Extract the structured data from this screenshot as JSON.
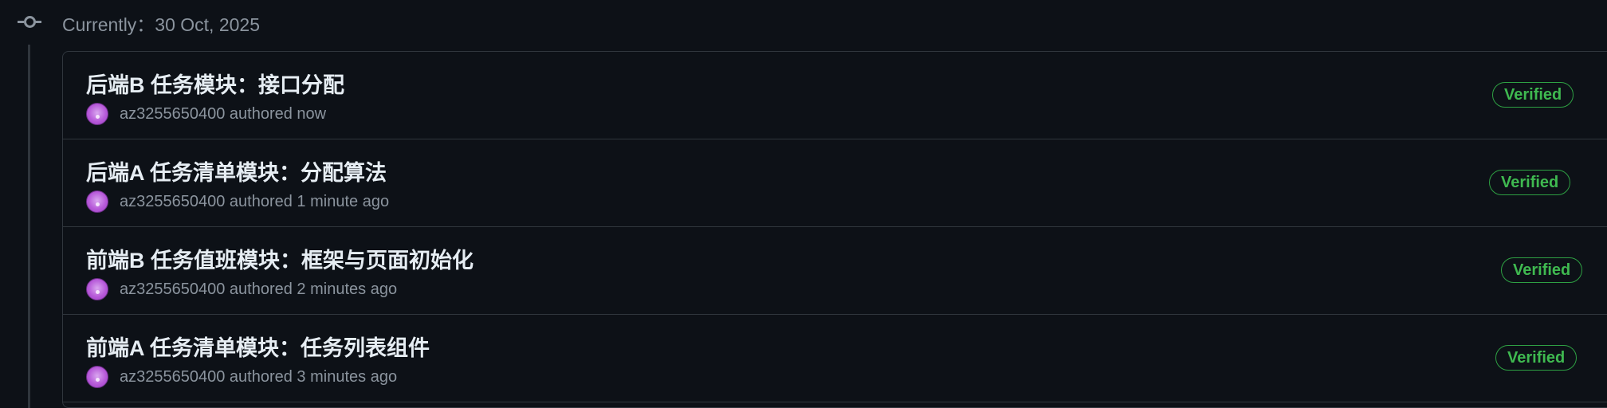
{
  "timeline": {
    "date_label": "Currently：30 Oct, 2025"
  },
  "commits": [
    {
      "title": "后端B 任务模块：接口分配",
      "author": "az3255650400",
      "authored_text": "authored now",
      "badge": "Verified"
    },
    {
      "title": "后端A 任务清单模块：分配算法",
      "author": "az3255650400",
      "authored_text": "authored 1 minute ago",
      "badge": "Verified"
    },
    {
      "title": "前端B 任务值班模块：框架与页面初始化",
      "author": "az3255650400",
      "authored_text": "authored 2 minutes ago",
      "badge": "Verified"
    },
    {
      "title": "前端A 任务清单模块：任务列表组件",
      "author": "az3255650400",
      "authored_text": "authored 3 minutes ago",
      "badge": "Verified"
    }
  ],
  "colors": {
    "background": "#0d1117",
    "border": "#30363d",
    "verified": "#3fb950",
    "avatar": "#b75ad9",
    "muted_text": "#8b949e"
  },
  "icons": {
    "timeline": "git-commit-icon",
    "avatar": "user-avatar"
  }
}
